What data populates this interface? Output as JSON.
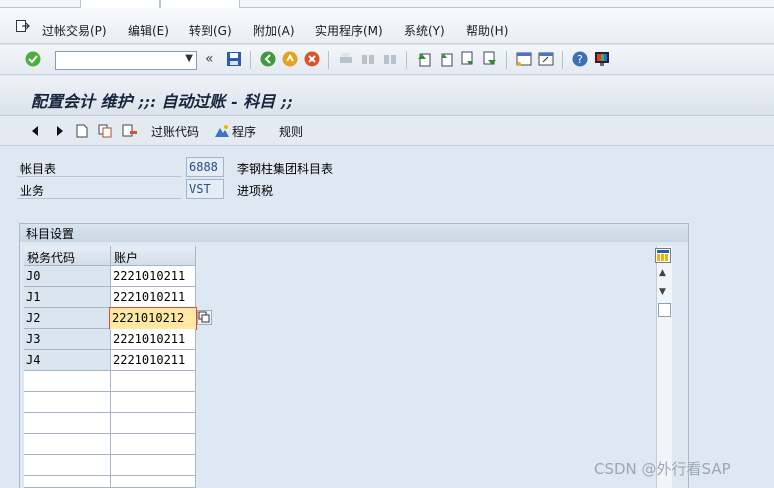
{
  "menu": {
    "items": [
      {
        "label": "过帐交易(P)"
      },
      {
        "label": "编辑(E)"
      },
      {
        "label": "转到(G)"
      },
      {
        "label": "附加(A)"
      },
      {
        "label": "实用程序(M)"
      },
      {
        "label": "系统(Y)"
      },
      {
        "label": "帮助(H)"
      }
    ]
  },
  "toolbar": {
    "command_value": "",
    "double_arrow": "«"
  },
  "title": "配置会计 维护 ;;: 自动过账 - 科目 ;;",
  "app_toolbar": {
    "posting_code_label": "过账代码",
    "program_label": "程序",
    "rules_label": "规则"
  },
  "fields": {
    "chart_of_accounts": {
      "label": "帐目表",
      "value": "6888",
      "description": "李钢柱集团科目表"
    },
    "transaction": {
      "label": "业务",
      "value": "VST",
      "description": "进项税"
    }
  },
  "group": {
    "title": "科目设置",
    "columns": [
      "税务代码",
      "账户"
    ],
    "rows": [
      {
        "tax_code": "J0",
        "account": "2221010211"
      },
      {
        "tax_code": "J1",
        "account": "2221010211"
      },
      {
        "tax_code": "J2",
        "account": "2221010212"
      },
      {
        "tax_code": "J3",
        "account": "2221010211"
      },
      {
        "tax_code": "J4",
        "account": "2221010211"
      }
    ]
  },
  "watermark": "CSDN @外行看SAP",
  "colors": {
    "accent": "#2a4d85",
    "highlight": "#ffe8a3",
    "error_border": "#d94a3a"
  }
}
